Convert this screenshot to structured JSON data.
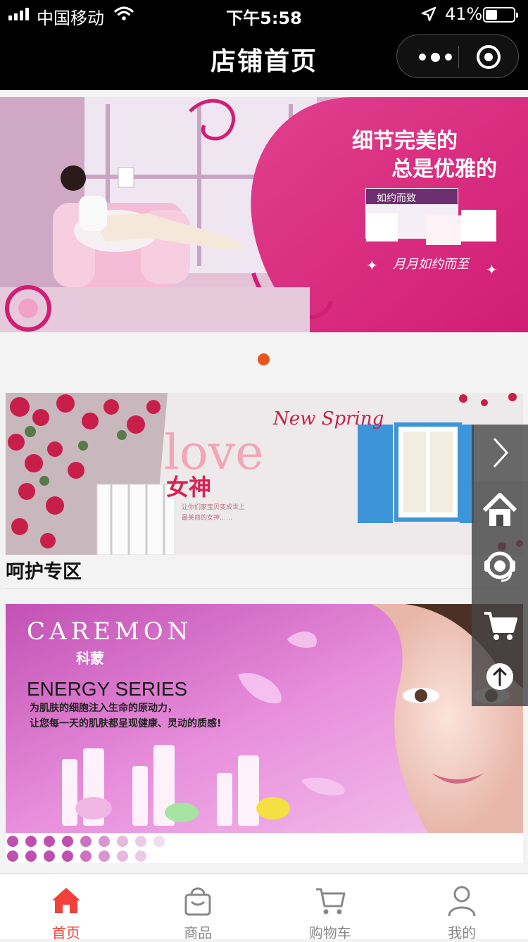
{
  "status_bar": {
    "carrier": "中国移动",
    "time": "下午5:58",
    "battery_percent": "41%",
    "battery_level": 0.41
  },
  "nav": {
    "title": "店铺首页",
    "more_icon": "more-dots-icon",
    "close_icon": "capsule-close-icon"
  },
  "banner": {
    "headline_1": "细节完美的",
    "headline_2": "总是优雅的",
    "tagline": "月月如约而至",
    "product_brand": "如约而致",
    "accent_color": "#e7358a",
    "active_indicator_index": 0,
    "indicator_color": "#e8541e"
  },
  "promo1": {
    "script_text": "New Spring",
    "love_text": "love",
    "goddess_text": "女神",
    "small_line_1": "让你们家宝贝变成世上",
    "small_line_2": "最美丽的女神……"
  },
  "sections": [
    {
      "title": "呵护专区"
    }
  ],
  "promo2": {
    "brand": "CAREMON",
    "brand_cn": "科蒙",
    "series": "ENERGY SERIES",
    "copy_line_1": "为肌肤的细胞注入生命的原动力，",
    "copy_line_2": "让您每一天的肌肤都呈现健康、灵动的质感!"
  },
  "float_bar": {
    "toggle_icon": "chevron-right-icon",
    "home_icon": "home-icon",
    "service_icon": "customer-service-icon",
    "cart_icon": "cart-icon",
    "top_icon": "arrow-up-icon"
  },
  "tabs": [
    {
      "label": "首页",
      "icon": "home-icon",
      "active": true
    },
    {
      "label": "商品",
      "icon": "bag-icon",
      "active": false
    },
    {
      "label": "购物车",
      "icon": "cart-icon",
      "active": false
    },
    {
      "label": "我的",
      "icon": "user-icon",
      "active": false
    }
  ],
  "colors": {
    "tab_active": "#f2403a",
    "tab_inactive": "#888888"
  }
}
